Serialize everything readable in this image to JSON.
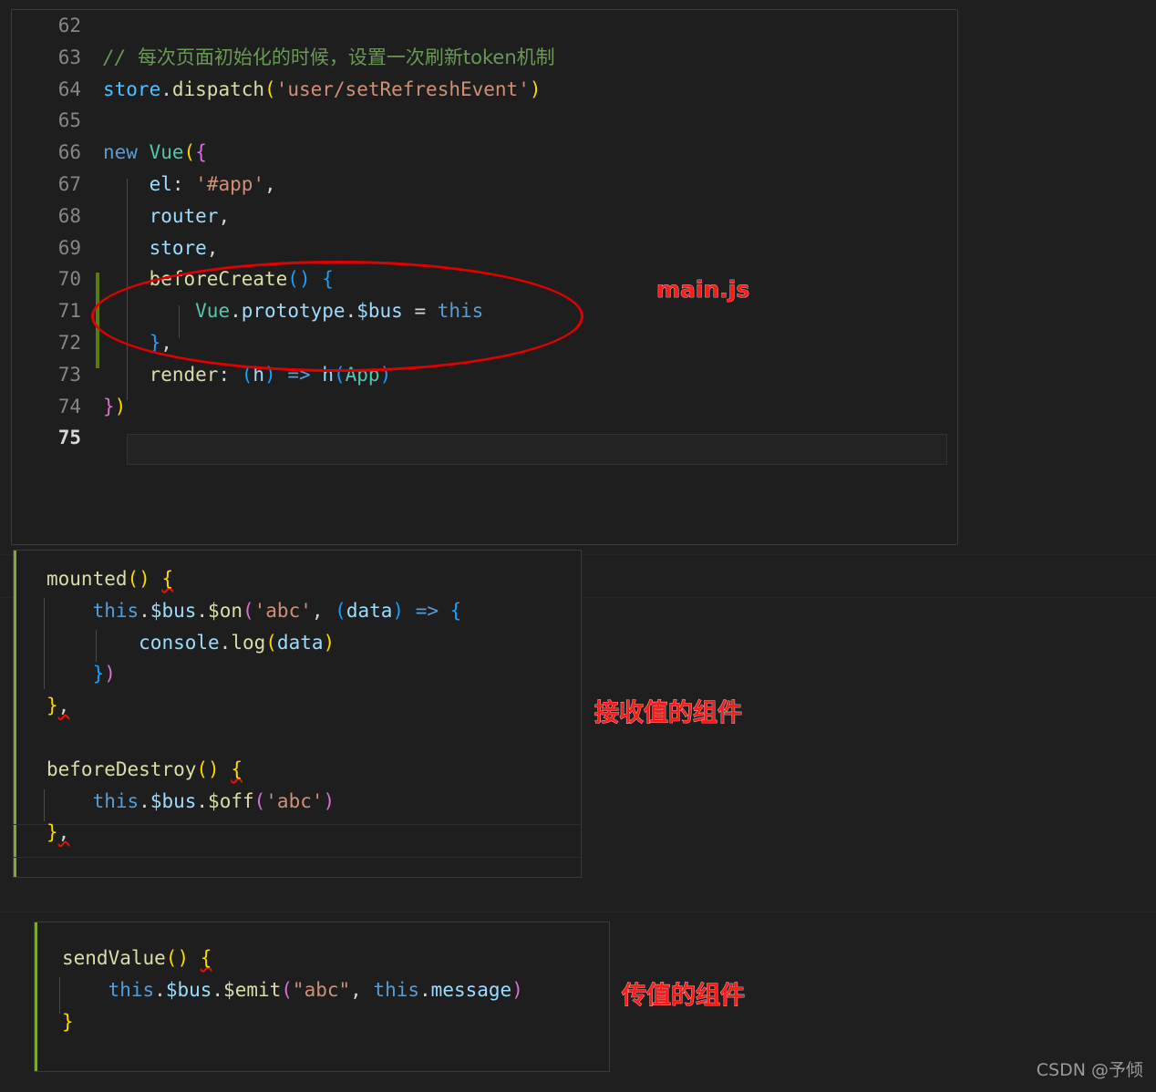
{
  "editor": {
    "file_label": "main.js",
    "line_numbers": [
      "62",
      "63",
      "64",
      "65",
      "66",
      "67",
      "68",
      "69",
      "70",
      "71",
      "72",
      "73",
      "74",
      "75"
    ],
    "active_line_number": "75",
    "lines": [
      "",
      "// 每次页面初始化的时候，设置一次刷新token机制",
      "store.dispatch('user/setRefreshEvent')",
      "",
      "new Vue({",
      "    el: '#app',",
      "    router,",
      "    store,",
      "    beforeCreate() {",
      "        Vue.prototype.$bus = this",
      "    },",
      "    render: (h) => h(App)",
      "})",
      ""
    ]
  },
  "receiver_block": {
    "annotation": "接收值的组件",
    "lines": [
      "mounted() {",
      "    this.$bus.$on('abc', (data) => {",
      "        console.log(data)",
      "    })",
      "},",
      "",
      "beforeDestroy() {",
      "    this.$bus.$off('abc')",
      "},"
    ]
  },
  "sender_block": {
    "annotation": "传值的组件",
    "lines": [
      "sendValue() {",
      "    this.$bus.$emit(\"abc\", this.message)",
      "}"
    ]
  },
  "annotations": {
    "main_js": "main.js",
    "receiver": "接收值的组件",
    "sender": "传值的组件",
    "highlight_color": "#e00000",
    "text_color": "#ff1a1a"
  },
  "watermark": "CSDN @予倾",
  "theme": {
    "background": "#1f1f1f",
    "panel_background": "#1e1e1e",
    "comment": "#6a9955",
    "string": "#ce9178",
    "keyword": "#569cd6",
    "function": "#dcdcaa",
    "variable": "#4fc1ff",
    "type": "#4ec9b0",
    "property": "#9cdcfe",
    "change_bar": "#587c0c"
  }
}
